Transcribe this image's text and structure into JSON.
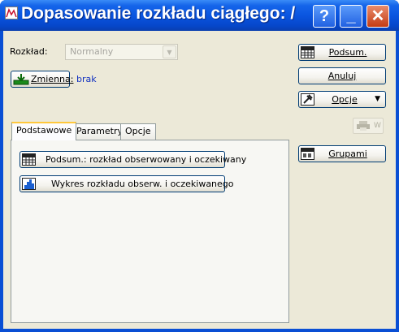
{
  "window": {
    "title": "Dopasowanie rozkładu ciągłego: /"
  },
  "titlebar_buttons": {
    "help": "?",
    "minimize": "_",
    "close": "✕"
  },
  "form": {
    "distribution_label": "Rozkład:",
    "distribution_value": "Normalny",
    "variable_button": "Zmienna:",
    "variable_value": "brak"
  },
  "actions": {
    "summary": "Podsum.",
    "cancel": "Anuluj",
    "options": "Opcje",
    "print_w": "W",
    "by_group": "Grupami"
  },
  "tabs": [
    "Podstawowe",
    "Parametry",
    "Opcje"
  ],
  "basic_tab": {
    "summary_button": "Podsum.: rozkład obserwowany i oczekiwany",
    "plot_button": "Wykres rozkładu obserw. i oczekiwanego"
  },
  "colors": {
    "title_bar": "#0a55e0",
    "client": "#ece9d8",
    "link": "#1030c0"
  }
}
